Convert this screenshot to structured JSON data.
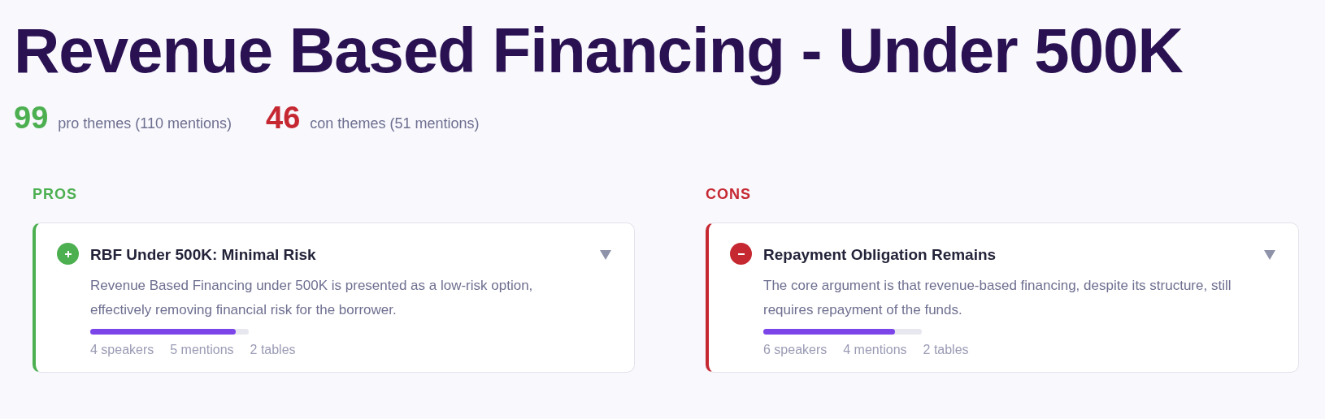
{
  "title": "Revenue Based Financing - Under 500K",
  "stats": [
    {
      "kind": "pro",
      "count": "99",
      "label": "pro themes (110 mentions)"
    },
    {
      "kind": "con",
      "count": "46",
      "label": "con themes (51 mentions)"
    }
  ],
  "columns": [
    {
      "kind": "pro",
      "heading": "PROS",
      "cards": [
        {
          "title": "RBF Under 500K: Minimal Risk",
          "description": "Revenue Based Financing under 500K is presented as a low-risk option, effectively removing financial risk for the borrower.",
          "level": 0.92,
          "meta": [
            "4 speakers",
            "5 mentions",
            "2 tables"
          ],
          "expanded": false
        }
      ]
    },
    {
      "kind": "con",
      "heading": "CONS",
      "cards": [
        {
          "title": "Repayment Obligation Remains",
          "description": "The core argument is that revenue-based financing, despite its structure, still requires repayment of the funds.",
          "level": 0.83,
          "meta": [
            "6 speakers",
            "4 mentions",
            "2 tables"
          ],
          "expanded": false
        }
      ]
    }
  ]
}
